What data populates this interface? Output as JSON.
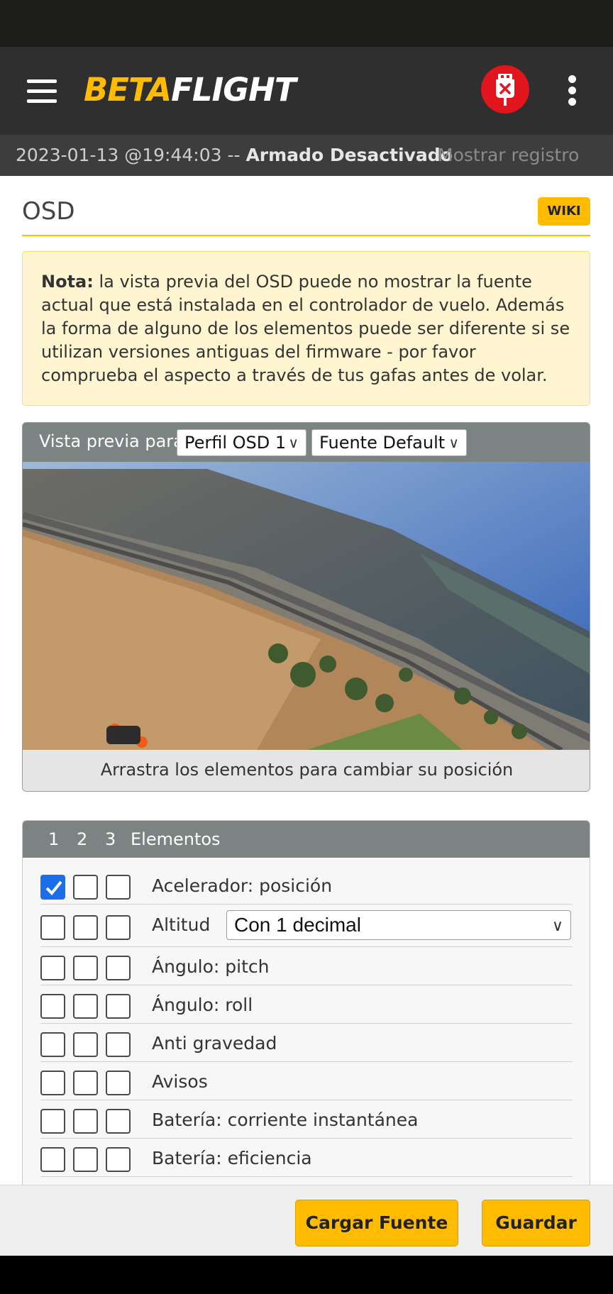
{
  "header": {
    "logo_beta": "BETA",
    "logo_flight": "FLIGHT"
  },
  "log_bar": {
    "timestamp": "2023-01-13 @19:44:03 -- ",
    "state": "Armado Desactivado",
    "show_log": "Mostrar registro"
  },
  "page": {
    "title": "OSD",
    "wiki": "WIKI"
  },
  "note": {
    "bold": "Nota:",
    "text": " la vista previa del OSD puede no mostrar la fuente actual que está instalada en el controlador de vuelo. Además la forma de alguno de los elementos puede ser diferente si se utilizan versiones antiguas del firmware - por favor comprueba el aspecto a través de tus gafas antes de volar."
  },
  "preview": {
    "label": "Vista previa para",
    "profile_select": "Perfil OSD 1",
    "font_select": "Fuente Default",
    "footer": "Arrastra los elementos para cambiar su posición"
  },
  "elements": {
    "tabs": [
      "1",
      "2",
      "3"
    ],
    "heading": "Elementos",
    "rows": [
      {
        "label": "Acelerador: posición",
        "checks": [
          true,
          false,
          false
        ]
      },
      {
        "label": "Altitud",
        "checks": [
          false,
          false,
          false
        ],
        "select": "Con 1 decimal"
      },
      {
        "label": "Ángulo: pitch",
        "checks": [
          false,
          false,
          false
        ]
      },
      {
        "label": "Ángulo: roll",
        "checks": [
          false,
          false,
          false
        ]
      },
      {
        "label": "Anti gravedad",
        "checks": [
          false,
          false,
          false
        ]
      },
      {
        "label": "Avisos",
        "checks": [
          false,
          false,
          false
        ]
      },
      {
        "label": "Batería: corriente instantánea",
        "checks": [
          false,
          false,
          false
        ]
      },
      {
        "label": "Batería: eficiencia",
        "checks": [
          false,
          false,
          false
        ]
      }
    ]
  },
  "actions": {
    "load_font": "Cargar Fuente",
    "save": "Guardar"
  },
  "colors": {
    "accent": "#ffbb00",
    "header_bg": "#2f2f2f",
    "usb_red": "#e2141d",
    "checkbox_blue": "#1c6ee8"
  }
}
